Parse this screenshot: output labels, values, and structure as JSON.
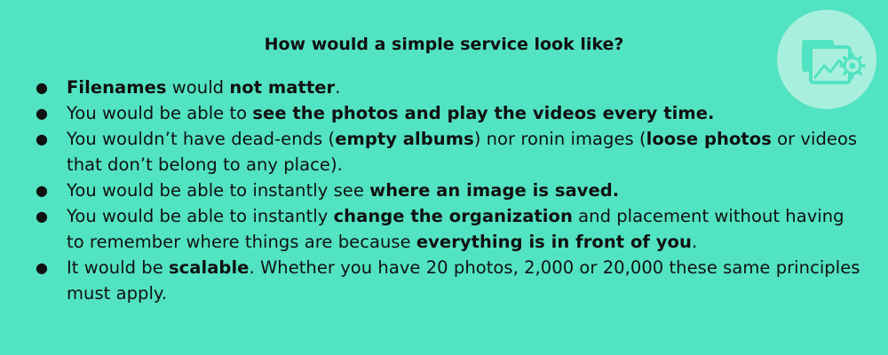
{
  "title": "How would a simple service look like?",
  "bullet_symbol": "●",
  "icon": {
    "name": "photo-gallery-settings-icon",
    "badge_color": "#a8f0dd",
    "glyph_color": "#52e3c2"
  },
  "background_color": "#52e3c2",
  "bullets": [
    {
      "segments": [
        {
          "text": "Filenames",
          "bold": true
        },
        {
          "text": " would ",
          "bold": false
        },
        {
          "text": "not matter",
          "bold": true
        },
        {
          "text": ".",
          "bold": false
        }
      ]
    },
    {
      "segments": [
        {
          "text": "You would be able to ",
          "bold": false
        },
        {
          "text": "see the photos and play the videos every time.",
          "bold": true
        }
      ]
    },
    {
      "segments": [
        {
          "text": "You wouldn’t have dead-ends (",
          "bold": false
        },
        {
          "text": "empty albums",
          "bold": true
        },
        {
          "text": ") nor ronin images (",
          "bold": false
        },
        {
          "text": "loose photos",
          "bold": true
        },
        {
          "text": " or videos that don’t belong to any place).",
          "bold": false
        }
      ]
    },
    {
      "segments": [
        {
          "text": "You would be able to instantly see ",
          "bold": false
        },
        {
          "text": "where an image is saved.",
          "bold": true
        }
      ]
    },
    {
      "segments": [
        {
          "text": "You would be able to instantly ",
          "bold": false
        },
        {
          "text": "change the organization",
          "bold": true
        },
        {
          "text": " and placement without having to remember where things are because ",
          "bold": false
        },
        {
          "text": "everything is in front of you",
          "bold": true
        },
        {
          "text": ".",
          "bold": false
        }
      ]
    },
    {
      "segments": [
        {
          "text": "It would be ",
          "bold": false
        },
        {
          "text": "scalable",
          "bold": true
        },
        {
          "text": ". Whether you have 20 photos, 2,000 or 20,000 these same principles must apply.",
          "bold": false
        }
      ]
    }
  ]
}
